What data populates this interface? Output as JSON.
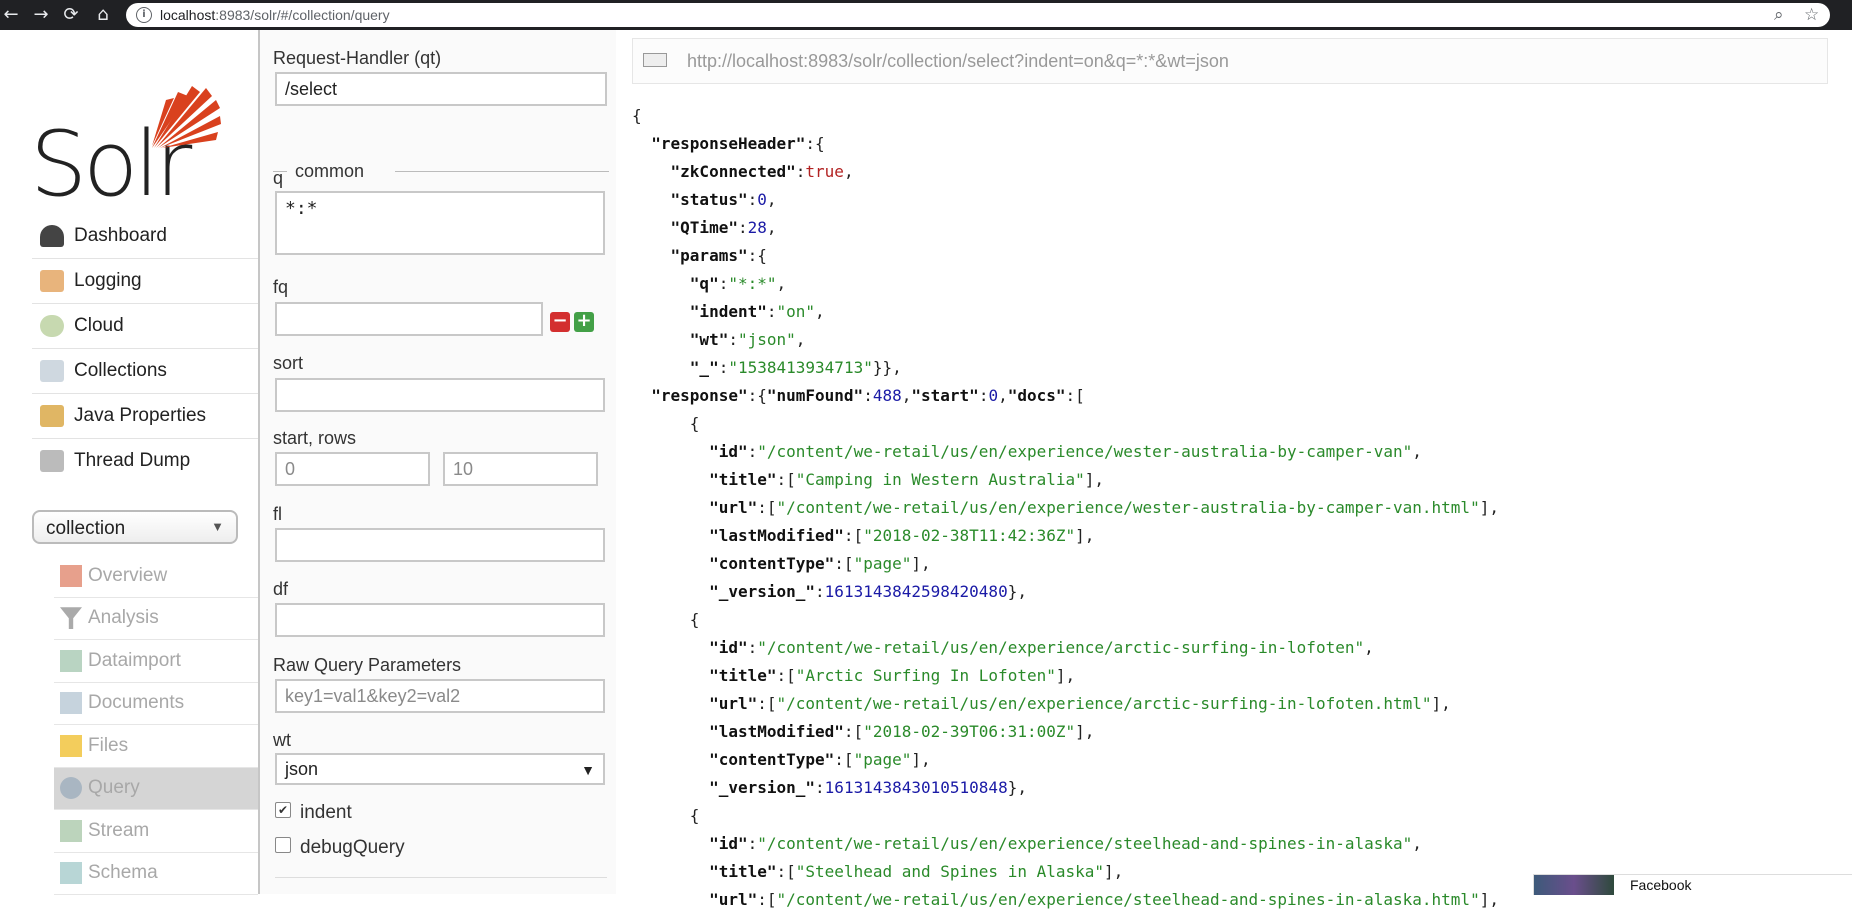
{
  "browser": {
    "url_host": "localhost",
    "url_rest": ":8983/solr/#/collection/query",
    "back_glyph": "←",
    "forward_glyph": "→",
    "reload_glyph": "⟳",
    "home_glyph": "⌂",
    "info_glyph": "i",
    "zoom_glyph": "⌕",
    "star_glyph": "☆"
  },
  "logo": {
    "text": "Solr"
  },
  "nav": [
    {
      "label": "Dashboard",
      "icon": "dashboard-icon",
      "color": "#333"
    },
    {
      "label": "Logging",
      "icon": "logging-icon",
      "color": "#d9a066"
    },
    {
      "label": "Cloud",
      "icon": "cloud-icon",
      "color": "#9ac06a"
    },
    {
      "label": "Collections",
      "icon": "collections-icon",
      "color": "#b0c4d8"
    },
    {
      "label": "Java Properties",
      "icon": "java-properties-icon",
      "color": "#d2a14e"
    },
    {
      "label": "Thread Dump",
      "icon": "thread-dump-icon",
      "color": "#999"
    }
  ],
  "core_selector": {
    "value": "collection",
    "arrow": "▼"
  },
  "subnav": [
    {
      "label": "Overview",
      "icon": "overview-icon",
      "color": "#d4735b"
    },
    {
      "label": "Analysis",
      "icon": "analysis-icon",
      "color": "#888"
    },
    {
      "label": "Dataimport",
      "icon": "dataimport-icon",
      "color": "#7a9"
    },
    {
      "label": "Documents",
      "icon": "documents-icon",
      "color": "#9ab"
    },
    {
      "label": "Files",
      "icon": "files-icon",
      "color": "#f0c040"
    },
    {
      "label": "Query",
      "icon": "query-icon",
      "color": "#7a8a9a"
    },
    {
      "label": "Stream",
      "icon": "stream-icon",
      "color": "#8a8"
    },
    {
      "label": "Schema",
      "icon": "schema-icon",
      "color": "#7aa"
    }
  ],
  "form": {
    "request_handler_label": "Request-Handler (qt)",
    "request_handler_value": "/select",
    "section_common": "common",
    "q_label": "q",
    "q_value": "*:*",
    "fq_label": "fq",
    "fq_value": "",
    "minus": "−",
    "plus": "+",
    "sort_label": "sort",
    "sort_value": "",
    "start_rows_label": "start, rows",
    "start_placeholder": "0",
    "rows_placeholder": "10",
    "fl_label": "fl",
    "fl_value": "",
    "df_label": "df",
    "df_value": "",
    "raw_label": "Raw Query Parameters",
    "raw_placeholder": "key1=val1&key2=val2",
    "wt_label": "wt",
    "wt_value": "json",
    "wt_arrow": "▼",
    "indent_label": "indent",
    "indent_checked": "✔",
    "debug_label": "debugQuery"
  },
  "results": {
    "request_url": "http://localhost:8983/solr/collection/select?indent=on&q=*:*&wt=json"
  },
  "response": {
    "zkConnected": "true",
    "status": "0",
    "QTime": "28",
    "params": {
      "q": "\"*:*\"",
      "indent": "\"on\"",
      "wt": "\"json\"",
      "_": "\"1538413934713\""
    },
    "numFound": "488",
    "start": "0",
    "docs": [
      {
        "id": "\"/content/we-retail/us/en/experience/wester-australia-by-camper-van\"",
        "title": "\"Camping in Western Australia\"",
        "url": "\"/content/we-retail/us/en/experience/wester-australia-by-camper-van.html\"",
        "lastModified": "\"2018-02-38T11:42:36Z\"",
        "contentType": "\"page\"",
        "version": "1613143842598420480"
      },
      {
        "id": "\"/content/we-retail/us/en/experience/arctic-surfing-in-lofoten\"",
        "title": "\"Arctic Surfing In Lofoten\"",
        "url": "\"/content/we-retail/us/en/experience/arctic-surfing-in-lofoten.html\"",
        "lastModified": "\"2018-02-39T06:31:00Z\"",
        "contentType": "\"page\"",
        "version": "1613143843010510848"
      },
      {
        "id": "\"/content/we-retail/us/en/experience/steelhead-and-spines-in-alaska\"",
        "title": "\"Steelhead and Spines in Alaska\"",
        "url": "\"/content/we-retail/us/en/experience/steelhead-and-spines-in-alaska.html\""
      }
    ]
  },
  "popup": {
    "name": "Facebook"
  },
  "colors": {
    "accent": "#d9411e",
    "minus": "#d32f2f",
    "plus": "#43a047"
  }
}
